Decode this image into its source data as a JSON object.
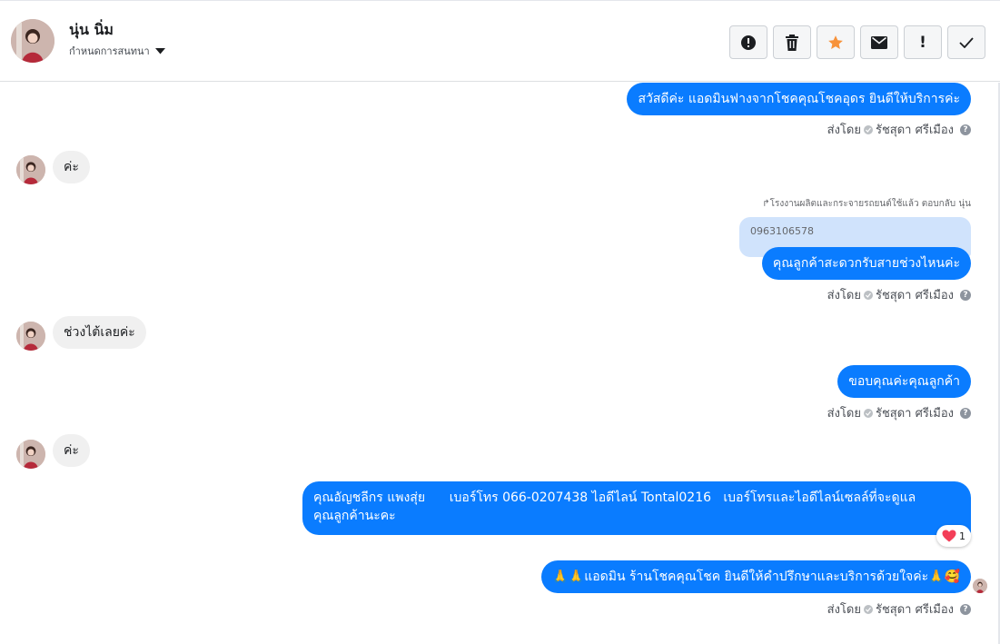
{
  "header": {
    "contact_name": "นุ่น นิ่ม",
    "assign_label": "กำหนดการสนทนา"
  },
  "toolbar": {
    "buttons": [
      "report-icon",
      "trash-icon",
      "star-icon",
      "envelope-icon",
      "exclamation-icon",
      "checkmark-icon"
    ],
    "exclamation_label": "!"
  },
  "messages": {
    "m1": {
      "text": "สวัสดีค่ะ แอดมินฟางจากโชคคุณโชคอุดร ยินดีให้บริการค่ะ"
    },
    "m2": {
      "text": "ค่ะ"
    },
    "reply_note": "↱โรงงานผลิตและกระจายรถยนต์ใช้แล้ว ตอบกลับ นุ่น",
    "quoted_text": "0963106578",
    "m3": {
      "text": "คุณลูกค้าสะดวกรับสายช่วงไหนค่ะ"
    },
    "m4": {
      "text": "ช่วงไต้เลยค่ะ"
    },
    "m5": {
      "text": "ขอบคุณค่ะคุณลูกค้า"
    },
    "m6": {
      "text": "ค่ะ"
    },
    "m7": {
      "line1": "คุณอัญชลีกร แพงสุ่ย      เบอร์โทร 066-0207438 ไอดีไลน์ Tontal0216   เบอร์โทรและไอดีไลน์เซลล์ที่จะดูแล",
      "line2": "คุณลูกค้านะคะ",
      "reaction_count": "1"
    },
    "m8": {
      "text": "🙏🙏แอดมิน ร้านโชคคุณโชค ยินดีให้คำปรึกษาและบริการด้วยใจค่ะ🙏🥰"
    }
  },
  "sent_by": {
    "prefix": "ส่งโดย",
    "agent": "รัชสุดา ศรีเมือง",
    "help": "?"
  },
  "colors": {
    "outgoing_bubble": "#0a7cff",
    "incoming_bubble": "#f0f0f0",
    "star": "#f7923a",
    "heart": "#f33e58"
  }
}
